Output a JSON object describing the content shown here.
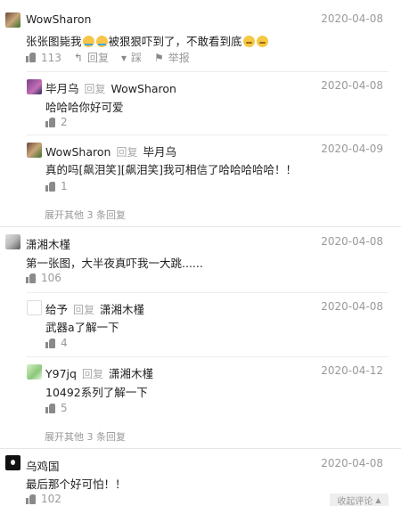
{
  "labels": {
    "reply": "回复",
    "report": "举报",
    "downvote": "踩"
  },
  "comments": [
    {
      "user": "WowSharon",
      "date": "2020-04-08",
      "text_a": "张张图毙我",
      "text_b": "被狠狠吓到了，不敢看到底",
      "likes": "113"
    },
    {
      "user": "毕月乌",
      "reply_to": "WowSharon",
      "date": "2020-04-08",
      "text": "哈哈哈你好可爱",
      "likes": "2"
    },
    {
      "user": "WowSharon",
      "reply_to": "毕月乌",
      "date": "2020-04-09",
      "text": "真的吗[飙泪笑][飙泪笑]我可相信了哈哈哈哈哈！！",
      "likes": "1"
    },
    {
      "expand": "展开其他 3 条回复"
    },
    {
      "user": "潇湘木槿",
      "date": "2020-04-08",
      "text": "第一张图，大半夜真吓我一大跳......",
      "likes": "106"
    },
    {
      "user": "给予",
      "reply_to": "潇湘木槿",
      "date": "2020-04-08",
      "text": "武器a了解一下",
      "likes": "4"
    },
    {
      "user": "Y97jq",
      "reply_to": "潇湘木槿",
      "date": "2020-04-12",
      "text": "10492系列了解一下",
      "likes": "5"
    },
    {
      "expand": "展开其他 3 条回复"
    },
    {
      "user": "乌鸡国",
      "date": "2020-04-08",
      "text": "最后那个好可怕！！",
      "likes": "102"
    }
  ],
  "collapse": "收起评论"
}
